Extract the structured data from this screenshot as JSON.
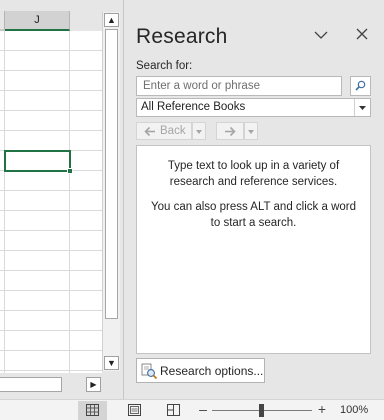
{
  "sheet": {
    "columns": [
      "",
      "J",
      ""
    ],
    "hscroll_right_icon": "scroll-right-arrow",
    "vscroll_up_icon": "scroll-up-arrow",
    "vscroll_down_icon": "scroll-down-arrow"
  },
  "pane": {
    "title": "Research",
    "collapse_icon": "chevron-down-icon",
    "close_icon": "close-icon",
    "search_label": "Search for:",
    "search_value": "",
    "search_placeholder": "Enter a word or phrase",
    "search_go_icon": "start-searching-icon",
    "reference_select": "All Reference Books",
    "back_label": "Back",
    "results_text_1": "Type text to look up in a variety of research and reference services.",
    "results_text_2": "You can also press ALT and click a word to start a search.",
    "options_label": "Research options..."
  },
  "status": {
    "zoom_level": "100%",
    "zoom_percent": 100
  },
  "colors": {
    "accent": "#217346",
    "pane_bg": "#e6e6e6"
  }
}
